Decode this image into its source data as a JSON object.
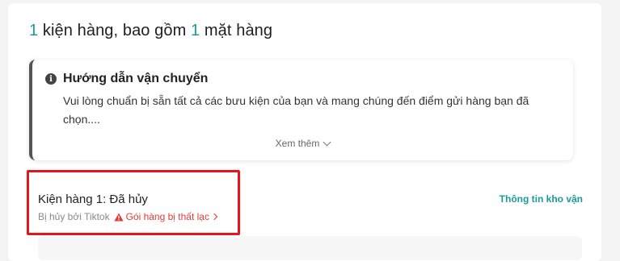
{
  "header": {
    "count_packages": "1",
    "text_packages": " kiện hàng, bao gồm ",
    "count_items": "1",
    "text_items": " mặt hàng"
  },
  "guide": {
    "title": "Hướng dẫn vận chuyển",
    "body": "Vui lòng chuẩn bị sẵn tất cả các bưu kiện của bạn và mang chúng đến điểm gửi hàng bạn đã chọn....",
    "see_more": "Xem thêm"
  },
  "package": {
    "title": "Kiện hàng 1: Đã hủy",
    "cancelled_by": "Bị hủy bởi Tiktok",
    "lost_label": "Gói hàng bị thất lạc",
    "logistics_link": "Thông tin kho vận"
  },
  "colors": {
    "accent": "#1a9b9b",
    "danger": "#e53935",
    "highlight": "#e8141c"
  }
}
